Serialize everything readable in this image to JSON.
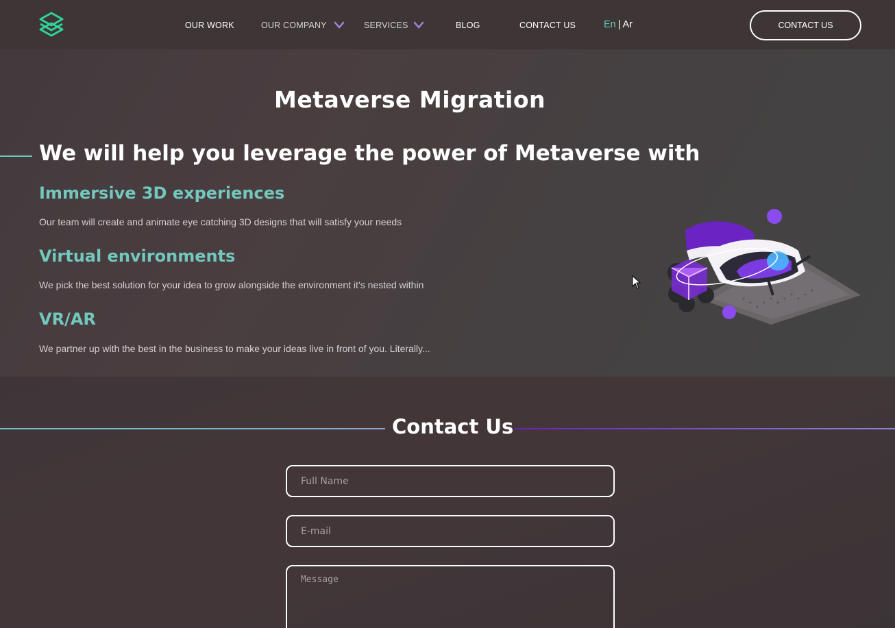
{
  "header": {
    "logo": "brand-logo",
    "nav": [
      {
        "label": "OUR WORK",
        "dropdown": false
      },
      {
        "label": "OUR COMPANY",
        "dropdown": true
      },
      {
        "label": "SERVICES",
        "dropdown": true
      },
      {
        "label": "BLOG",
        "dropdown": false
      },
      {
        "label": "CONTACT US",
        "dropdown": false
      }
    ],
    "lang": {
      "en": "En",
      "separator": "|",
      "ar": "Ar"
    },
    "cta": "CONTACT US"
  },
  "hero": {
    "title": "Metaverse Migration",
    "lead": "We will help you leverage the power of Metaverse with",
    "features": [
      {
        "title": "Immersive 3D experiences",
        "desc": "Our team will create and animate eye catching 3D designs that will satisfy your needs"
      },
      {
        "title": "Virtual environments",
        "desc": "We pick the best solution for your idea to grow alongside the environment it’s nested within"
      },
      {
        "title": "VR/AR",
        "desc": "We partner up with the best in the business to make your ideas live in front of you. Literally..."
      }
    ],
    "illustration": "vr-headset-illustration"
  },
  "contact": {
    "title": "Contact Us",
    "fields": {
      "name_placeholder": "Full Name",
      "email_placeholder": "E-mail",
      "message_placeholder": "Message"
    }
  },
  "colors": {
    "accent_teal": "#66c9bd",
    "accent_purple": "#7a3fd0",
    "background": "#3d3537"
  }
}
